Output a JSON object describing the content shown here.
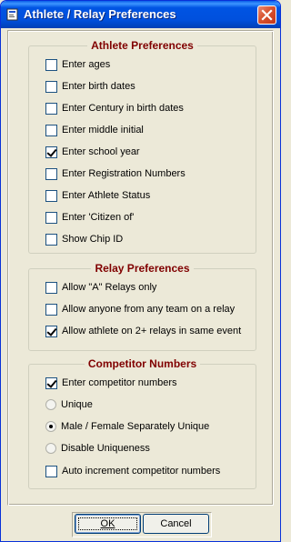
{
  "window": {
    "title": "Athlete / Relay Preferences"
  },
  "athlete_preferences": {
    "title": "Athlete Preferences",
    "items": [
      {
        "label": "Enter ages",
        "checked": false
      },
      {
        "label": "Enter birth dates",
        "checked": false
      },
      {
        "label": "Enter Century in birth dates",
        "checked": false
      },
      {
        "label": "Enter middle initial",
        "checked": false
      },
      {
        "label": "Enter school year",
        "checked": true
      },
      {
        "label": "Enter Registration Numbers",
        "checked": false
      },
      {
        "label": "Enter Athlete Status",
        "checked": false
      },
      {
        "label": "Enter 'Citizen of'",
        "checked": false
      },
      {
        "label": "Show Chip ID",
        "checked": false
      }
    ]
  },
  "relay_preferences": {
    "title": "Relay Preferences",
    "items": [
      {
        "label": "Allow \"A\" Relays only",
        "checked": false
      },
      {
        "label": "Allow anyone from any team on a relay",
        "checked": false
      },
      {
        "label": "Allow athlete on 2+ relays in same event",
        "checked": true
      }
    ]
  },
  "competitor_numbers": {
    "title": "Competitor Numbers",
    "enter_numbers": {
      "label": "Enter competitor numbers",
      "checked": true
    },
    "options": [
      {
        "label": "Unique",
        "selected": false
      },
      {
        "label": "Male / Female Separately Unique",
        "selected": true
      },
      {
        "label": "Disable Uniqueness",
        "selected": false
      }
    ],
    "auto_increment": {
      "label": "Auto increment competitor numbers",
      "checked": false
    }
  },
  "buttons": {
    "ok": "OK",
    "cancel": "Cancel"
  },
  "colors": {
    "title_bar": "#0054e3",
    "group_title": "#800000",
    "dialog_bg": "#ece9d8"
  }
}
